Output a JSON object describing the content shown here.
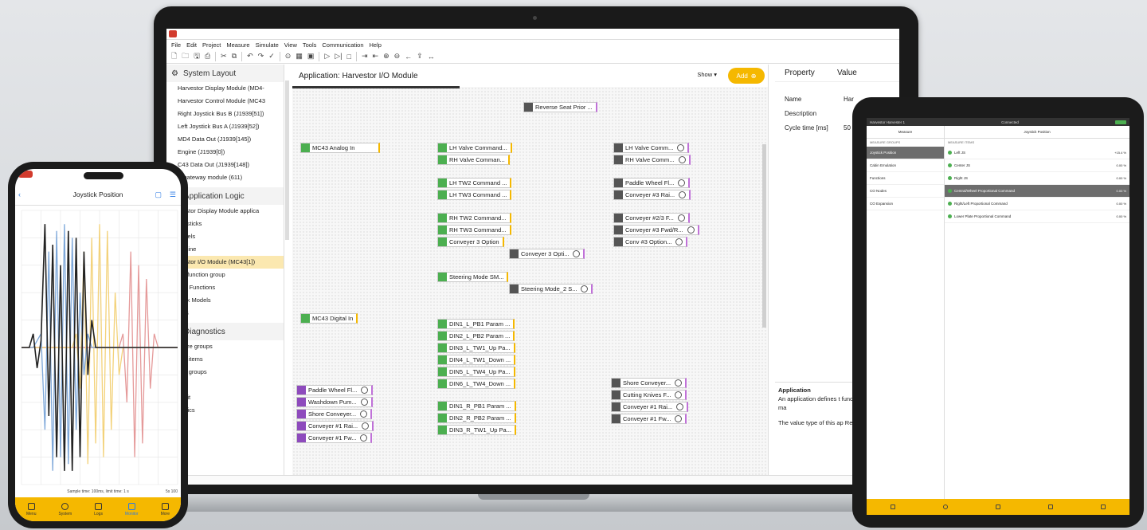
{
  "laptop": {
    "menu": [
      "File",
      "Edit",
      "Project",
      "Measure",
      "Simulate",
      "View",
      "Tools",
      "Communication",
      "Help"
    ],
    "sidebar": {
      "system_layout": {
        "title": "System Layout",
        "items": [
          "Harvestor Display Module (MD4-",
          "Harvestor Control Module (MC43",
          "Right Joystick Bus B (J1939[51])",
          "Left Joystick Bus A (J1939[52])",
          "MD4 Data Out (J1939[145])",
          "Engine (J1939[0])",
          "C43 Data Out (J1939[148])",
          "is gateway module (611)"
        ]
      },
      "application_logic": {
        "title": "Application Logic",
        "items": [
          "rvestor Display Module applica",
          "Joysticks",
          "Labels",
          "Engine",
          "rvestor I/O Module (MC43[1])",
          "I/O function group",
          "rnal Functions",
          "ulink Models",
          "nels"
        ]
      },
      "diagnostics": {
        "title": "Diagnostics",
        "items": [
          "asure groups",
          "sult items",
          "sult groups",
          "s",
          "T init",
          "matics"
        ]
      }
    },
    "canvas": {
      "title": "Application: Harvestor I/O Module",
      "show_label": "Show",
      "add_label": "Add",
      "nodes": [
        {
          "label": "Reverse Seat Prior ...",
          "kind": "gray"
        },
        {
          "label": "MC43 Analog In",
          "kind": "green"
        },
        {
          "label": "LH Valve Command...",
          "kind": "green"
        },
        {
          "label": "RH Valve Comman...",
          "kind": "green"
        },
        {
          "label": "LH Valve Comm...",
          "kind": "gray"
        },
        {
          "label": "RH Valve Comm...",
          "kind": "gray"
        },
        {
          "label": "LH TW2 Command ...",
          "kind": "green"
        },
        {
          "label": "LH TW3 Command ...",
          "kind": "green"
        },
        {
          "label": "Paddle Wheel Fl...",
          "kind": "gray"
        },
        {
          "label": "Conveyer #3 Rai...",
          "kind": "gray"
        },
        {
          "label": "RH TW2 Command...",
          "kind": "green"
        },
        {
          "label": "RH TW3 Command...",
          "kind": "green"
        },
        {
          "label": "Conveyer 3 Option",
          "kind": "green"
        },
        {
          "label": "Conveyer #2/3 F...",
          "kind": "gray"
        },
        {
          "label": "Conveyer #3 Fwd/R...",
          "kind": "gray"
        },
        {
          "label": "Conv #3 Option...",
          "kind": "gray"
        },
        {
          "label": "Conveyer 3 Opti...",
          "kind": "gray"
        },
        {
          "label": "Steering Mode SM...",
          "kind": "green"
        },
        {
          "label": "Steering Mode_2 S...",
          "kind": "gray"
        },
        {
          "label": "MC43 Digital In",
          "kind": "green"
        },
        {
          "label": "DIN1_L_PB1 Param ...",
          "kind": "green"
        },
        {
          "label": "DIN2_L_PB2 Param ...",
          "kind": "green"
        },
        {
          "label": "DIN3_L_TW1_Up Pa...",
          "kind": "green"
        },
        {
          "label": "DIN4_L_TW1_Down ...",
          "kind": "green"
        },
        {
          "label": "DIN5_L_TW4_Up Pa...",
          "kind": "green"
        },
        {
          "label": "DIN6_L_TW4_Down ...",
          "kind": "green"
        },
        {
          "label": "Paddle Wheel Fl...",
          "kind": "purple"
        },
        {
          "label": "Washdown Pum...",
          "kind": "purple"
        },
        {
          "label": "Shore Conveyer...",
          "kind": "purple"
        },
        {
          "label": "Conveyer #1 Rai...",
          "kind": "purple"
        },
        {
          "label": "Conveyer #1 Fw...",
          "kind": "purple"
        },
        {
          "label": "Shore Conveyer...",
          "kind": "gray"
        },
        {
          "label": "Cutting Knives F...",
          "kind": "gray"
        },
        {
          "label": "Conveyer #1 Rai...",
          "kind": "gray"
        },
        {
          "label": "Conveyer #1 Fw...",
          "kind": "gray"
        },
        {
          "label": "DIN1_R_PB1 Param ...",
          "kind": "green"
        },
        {
          "label": "DIN2_R_PB2 Param ...",
          "kind": "green"
        },
        {
          "label": "DIN3_R_TW1_Up Pa...",
          "kind": "green"
        }
      ]
    },
    "properties": {
      "col_property": "Property",
      "col_value": "Value",
      "rows": [
        {
          "name": "Name",
          "value": "Har"
        },
        {
          "name": "Description",
          "value": ""
        },
        {
          "name": "Cycle time [ms]",
          "value": "50"
        }
      ],
      "desc_title": "Application",
      "desc_text": "An application defines t functionality for one ma",
      "desc_text2": "The value type of this ap Real."
    }
  },
  "phone": {
    "title": "Joystick Position",
    "caption": "Sample time: 100ms, limit time: 1 s",
    "caption_right": "5s 100",
    "nav": [
      "Menu",
      "System",
      "Logs",
      "Monitor",
      "More"
    ],
    "chart_data": {
      "type": "line",
      "title": "",
      "xlabel": "",
      "ylabel": "",
      "ylim": [
        -1,
        1
      ],
      "x": [
        0,
        1,
        2,
        3,
        4,
        5,
        6,
        7,
        8,
        9,
        10,
        11,
        12,
        13,
        14,
        15,
        16,
        17,
        18,
        19,
        20,
        21,
        22,
        23,
        24,
        25,
        26,
        27,
        28,
        29,
        30,
        31,
        32,
        33,
        34,
        35,
        36,
        37,
        38,
        39,
        40
      ],
      "series": [
        {
          "color": "#222222",
          "values": [
            0,
            0,
            0,
            0.1,
            -0.15,
            0.05,
            0.9,
            -0.5,
            0.75,
            -0.8,
            0.6,
            -0.9,
            0.85,
            -0.9,
            0.8,
            -0.8,
            0.7,
            -0.2,
            0.2,
            0,
            0,
            0,
            0,
            0,
            0,
            0,
            0,
            0,
            0,
            0,
            0,
            0,
            0,
            0,
            0,
            0,
            0,
            0,
            0,
            0,
            0
          ]
        },
        {
          "color": "#7da7d9",
          "values": [
            0,
            0,
            0,
            0,
            0.05,
            0.1,
            -0.6,
            0.7,
            -0.9,
            0.85,
            -0.8,
            0.9,
            -0.85,
            0.8,
            -0.6,
            0.4,
            -0.2,
            0.1,
            0,
            0,
            0,
            0,
            0,
            0,
            0,
            0,
            0,
            0,
            0,
            0,
            0,
            0,
            0,
            0,
            0,
            0,
            0,
            0,
            0,
            0,
            0
          ]
        },
        {
          "color": "#f3d27a",
          "values": [
            0,
            0,
            0,
            0,
            0,
            0,
            0,
            0,
            0,
            0,
            0,
            0,
            0,
            0,
            0.1,
            -0.3,
            0.7,
            -0.85,
            0.8,
            -0.7,
            0.9,
            -0.8,
            0.85,
            -0.6,
            0.4,
            -0.2,
            0,
            0,
            0,
            0,
            0,
            0,
            0,
            0,
            0,
            0,
            0,
            0,
            0,
            0,
            0
          ]
        },
        {
          "color": "#e59a9a",
          "values": [
            0,
            0,
            0,
            0,
            0,
            0,
            0,
            0,
            0,
            0,
            0,
            0,
            0,
            0,
            0,
            0,
            0,
            0,
            0,
            0,
            0,
            0,
            0,
            0,
            0,
            0,
            0.1,
            -0.4,
            0.7,
            -0.8,
            0.6,
            -0.7,
            0.5,
            -0.3,
            0.1,
            0,
            0,
            0,
            0,
            0,
            0
          ]
        },
        {
          "color": "#d2663a",
          "values": [
            0,
            0,
            0,
            0,
            0,
            0,
            0,
            0,
            0,
            0,
            0,
            0,
            0,
            0,
            0,
            0,
            0,
            0,
            0,
            0,
            0,
            0,
            0,
            0,
            0,
            0,
            0,
            0,
            0,
            0,
            0,
            0,
            0,
            0,
            0,
            0,
            0,
            0,
            0,
            0,
            0
          ]
        }
      ]
    }
  },
  "tablet": {
    "top_left": "Harvestor Harvester 1",
    "top_center": "Connected",
    "left_header": "Measure",
    "right_header": "Joystick Position",
    "left_section": "MEASURE GROUPS",
    "left_items": [
      "Joystick Position",
      "Cabin Emulation",
      "Functions",
      "CO Nodes",
      "CO Expansion"
    ],
    "right_section": "MEASURE ITEMS",
    "right_items": [
      {
        "label": "Left JS",
        "value": "+15.4 %"
      },
      {
        "label": "Center JS",
        "value": "0.00 %"
      },
      {
        "label": "Right JS",
        "value": "0.00 %"
      },
      {
        "label": "Central/Wheel Proportional Command",
        "value": "0.00 %"
      },
      {
        "label": "Right/Left Proportional Command",
        "value": "0.00 %"
      },
      {
        "label": "Lower Plate Proportional Command",
        "value": "0.00 %"
      }
    ]
  }
}
